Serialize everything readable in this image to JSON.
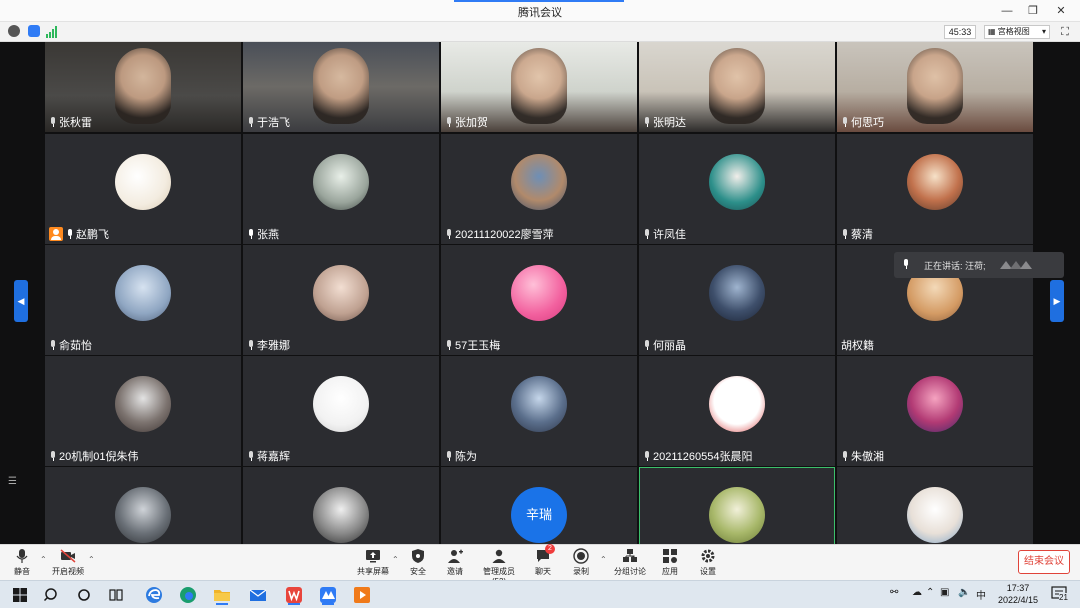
{
  "window": {
    "title": "腾讯会议"
  },
  "infobar": {
    "timer": "45:33",
    "view_label": "宫格视图"
  },
  "participants": [
    {
      "name": "张秋雷",
      "mic": "muted"
    },
    {
      "name": "于浩飞",
      "mic": "muted"
    },
    {
      "name": "张加贺",
      "mic": "muted"
    },
    {
      "name": "张明达",
      "mic": "muted"
    },
    {
      "name": "何思巧",
      "mic": "muted"
    },
    {
      "name": "赵鹏飞",
      "mic": "on",
      "host": true
    },
    {
      "name": "张燕",
      "mic": "on"
    },
    {
      "name": "20211120022廖雪萍",
      "mic": "muted"
    },
    {
      "name": "许凤佳",
      "mic": "muted"
    },
    {
      "name": "蔡清",
      "mic": "muted"
    },
    {
      "name": "俞茹怡",
      "mic": "muted"
    },
    {
      "name": "李雅娜",
      "mic": "muted"
    },
    {
      "name": "57王玉梅",
      "mic": "muted"
    },
    {
      "name": "何丽晶",
      "mic": "muted"
    },
    {
      "name": "胡权籍",
      "mic": "none"
    },
    {
      "name": "20机制01倪朱伟",
      "mic": "muted"
    },
    {
      "name": "蒋嘉辉",
      "mic": "muted"
    },
    {
      "name": "陈为",
      "mic": "muted"
    },
    {
      "name": "20211260554张晨阳",
      "mic": "muted"
    },
    {
      "name": "朱傲湘",
      "mic": "muted"
    },
    {
      "name": "",
      "mic": "none"
    },
    {
      "name": "",
      "mic": "none"
    },
    {
      "name": "",
      "mic": "none",
      "avatar_text": "辛瑞"
    },
    {
      "name": "",
      "mic": "none"
    },
    {
      "name": "",
      "mic": "none"
    }
  ],
  "speaking": {
    "label": "正在讲话: 汪荷;"
  },
  "toolbar": {
    "mute": "静音",
    "video": "开启视频",
    "share": "共享屏幕",
    "security": "安全",
    "invite": "邀请",
    "members": "管理成员(52)",
    "chat": "聊天",
    "chat_badge": "2",
    "record": "录制",
    "breakout": "分组讨论",
    "apps": "应用",
    "settings": "设置",
    "end": "结束会议"
  },
  "taskbar": {
    "ime": "中",
    "time": "17:37",
    "date": "2022/4/15",
    "notify_count": "21"
  }
}
